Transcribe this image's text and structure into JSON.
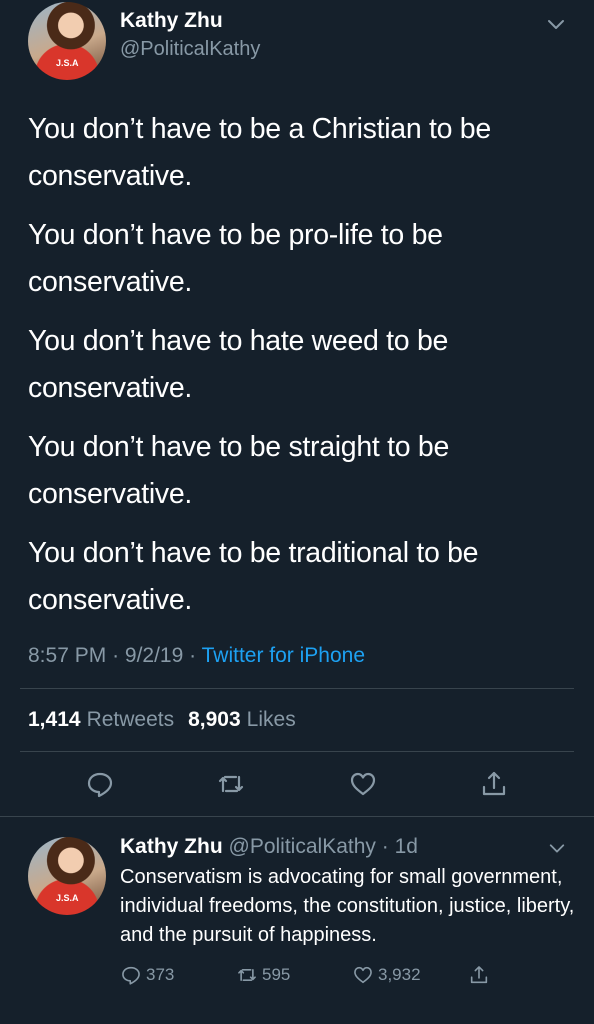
{
  "main_tweet": {
    "author_name": "Kathy Zhu",
    "author_handle": "@PoliticalKathy",
    "avatar_shirt_text": "J.S.A",
    "paragraphs": [
      "You don’t have to be a Christian to be conservative.",
      "You don’t have to be pro-life to be conservative.",
      "You don’t have to hate weed to be conservative.",
      "You don’t have to be straight to be conservative.",
      "You don’t have to be traditional to be conservative."
    ],
    "time": "8:57 PM",
    "date": "9/2/19",
    "separator": "·",
    "source": "Twitter for iPhone",
    "retweets_count": "1,414",
    "retweets_label": "Retweets",
    "likes_count": "8,903",
    "likes_label": "Likes",
    "actions": [
      "reply-icon",
      "retweet-icon",
      "like-icon",
      "share-icon"
    ]
  },
  "reply_tweet": {
    "author_name": "Kathy Zhu",
    "author_handle": "@PoliticalKathy",
    "age": "· 1d",
    "avatar_shirt_text": "J.S.A",
    "text": "Conservatism is advocating for small government, individual freedoms, the constitution, justice, liberty, and the pursuit of happiness.",
    "replies": "373",
    "retweets": "595",
    "likes": "3,932"
  },
  "colors": {
    "background": "#15202b",
    "secondary_text": "#8899a6",
    "link": "#1da1f2",
    "divider": "#38444d"
  }
}
